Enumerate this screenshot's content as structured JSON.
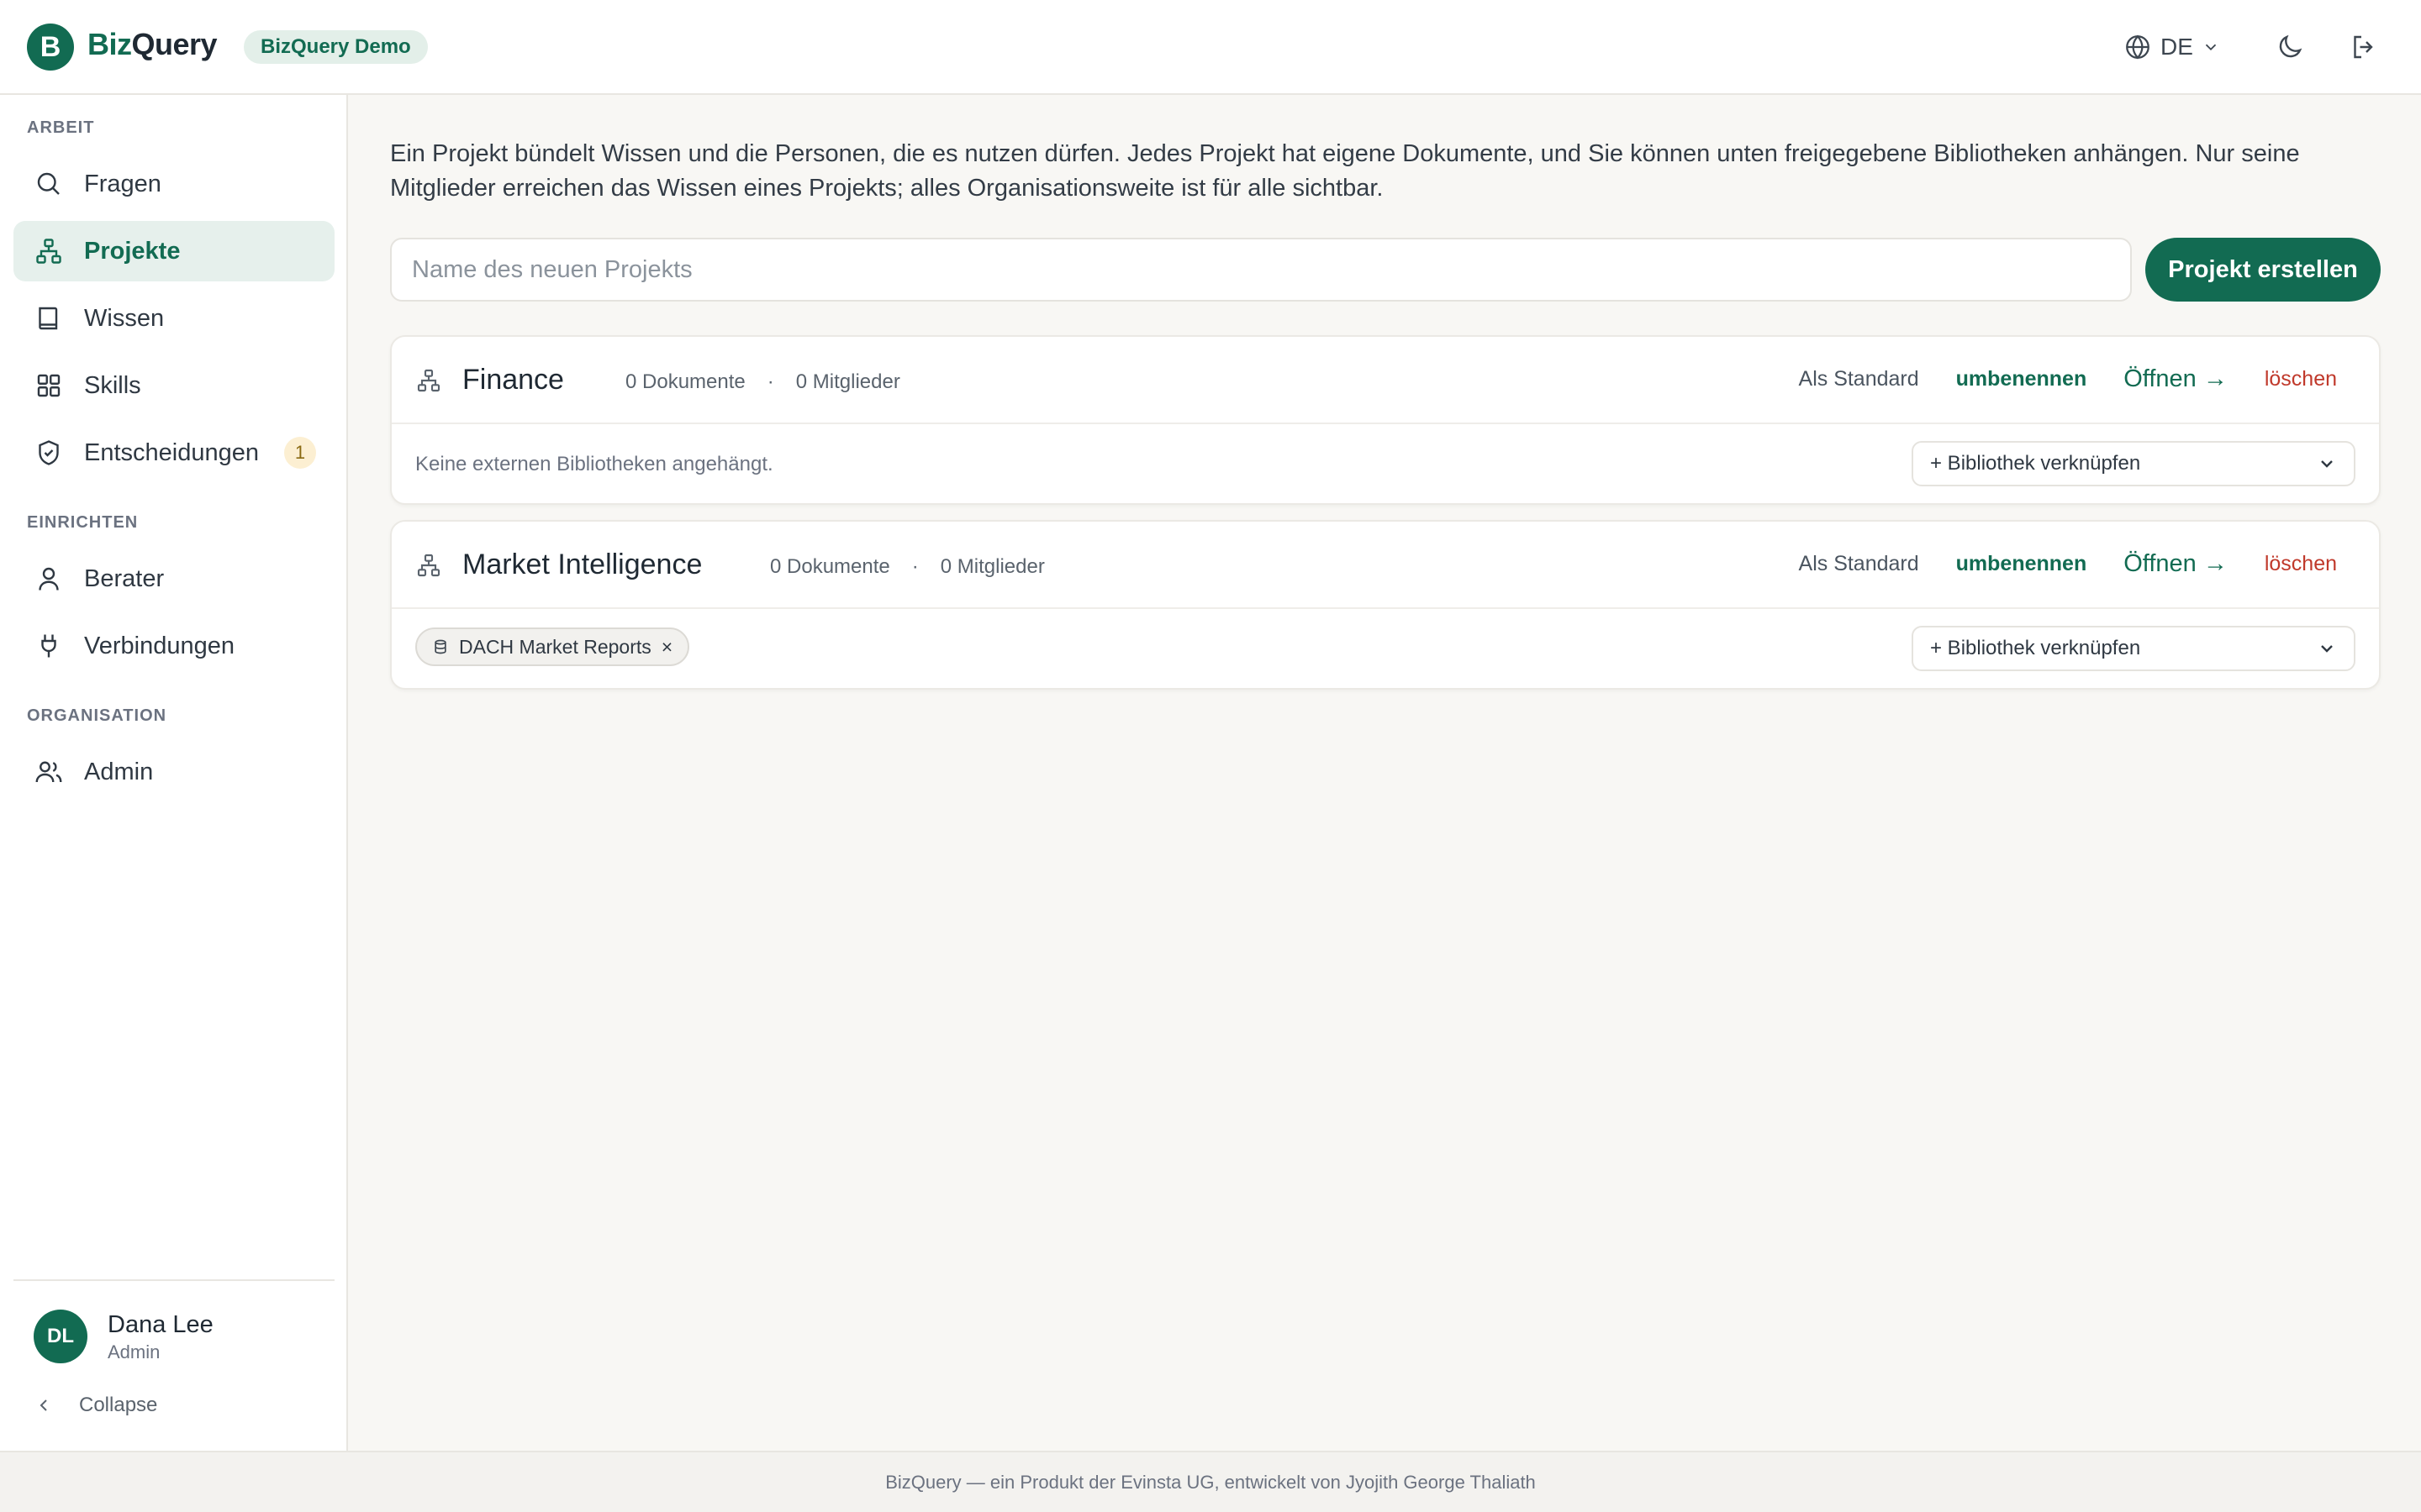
{
  "header": {
    "logo_letter": "B",
    "brand_part1": "Biz",
    "brand_part2": "Query",
    "demo_badge": "BizQuery Demo",
    "language": "DE"
  },
  "sidebar": {
    "sections": {
      "work": "ARBEIT",
      "setup": "EINRICHTEN",
      "org": "ORGANISATION"
    },
    "items": [
      {
        "label": "Fragen",
        "icon": "search-icon"
      },
      {
        "label": "Projekte",
        "icon": "project-icon",
        "active": true
      },
      {
        "label": "Wissen",
        "icon": "book-icon"
      },
      {
        "label": "Skills",
        "icon": "grid-icon"
      },
      {
        "label": "Entscheidungen",
        "icon": "shield-check-icon",
        "badge": "1"
      },
      {
        "label": "Berater",
        "icon": "user-icon"
      },
      {
        "label": "Verbindungen",
        "icon": "plug-icon"
      },
      {
        "label": "Admin",
        "icon": "users-icon"
      }
    ],
    "user": {
      "initials": "DL",
      "name": "Dana Lee",
      "role": "Admin"
    },
    "collapse_label": "Collapse"
  },
  "main": {
    "intro": "Ein Projekt bündelt Wissen und die Personen, die es nutzen dürfen. Jedes Projekt hat eigene Dokumente, und Sie können unten freigegebene Bibliotheken anhängen. Nur seine Mitglieder erreichen das Wissen eines Projekts; alles Organisationsweite ist für alle sichtbar.",
    "new_project_placeholder": "Name des neuen Projekts",
    "create_button": "Projekt erstellen",
    "projects": [
      {
        "name": "Finance",
        "documents": "0 Dokumente",
        "separator": "·",
        "members": "0 Mitglieder",
        "no_libraries": "Keine externen Bibliotheken angehängt.",
        "libraries": []
      },
      {
        "name": "Market Intelligence",
        "documents": "0 Dokumente",
        "separator": "·",
        "members": "0 Mitglieder",
        "no_libraries": "",
        "libraries": [
          "DACH Market Reports"
        ]
      }
    ],
    "actions": {
      "set_default": "Als Standard",
      "rename": "umbenennen",
      "open": "Öffnen →",
      "delete": "löschen",
      "link_library": "+ Bibliothek verknüpfen",
      "chip_remove": "×"
    }
  },
  "footer": {
    "text": "BizQuery — ein Produkt der Evinsta UG, entwickelt von Jyojith George Thaliath"
  },
  "colors": {
    "brand": "#126b52",
    "danger": "#c0392b",
    "background": "#f8f7f4"
  }
}
